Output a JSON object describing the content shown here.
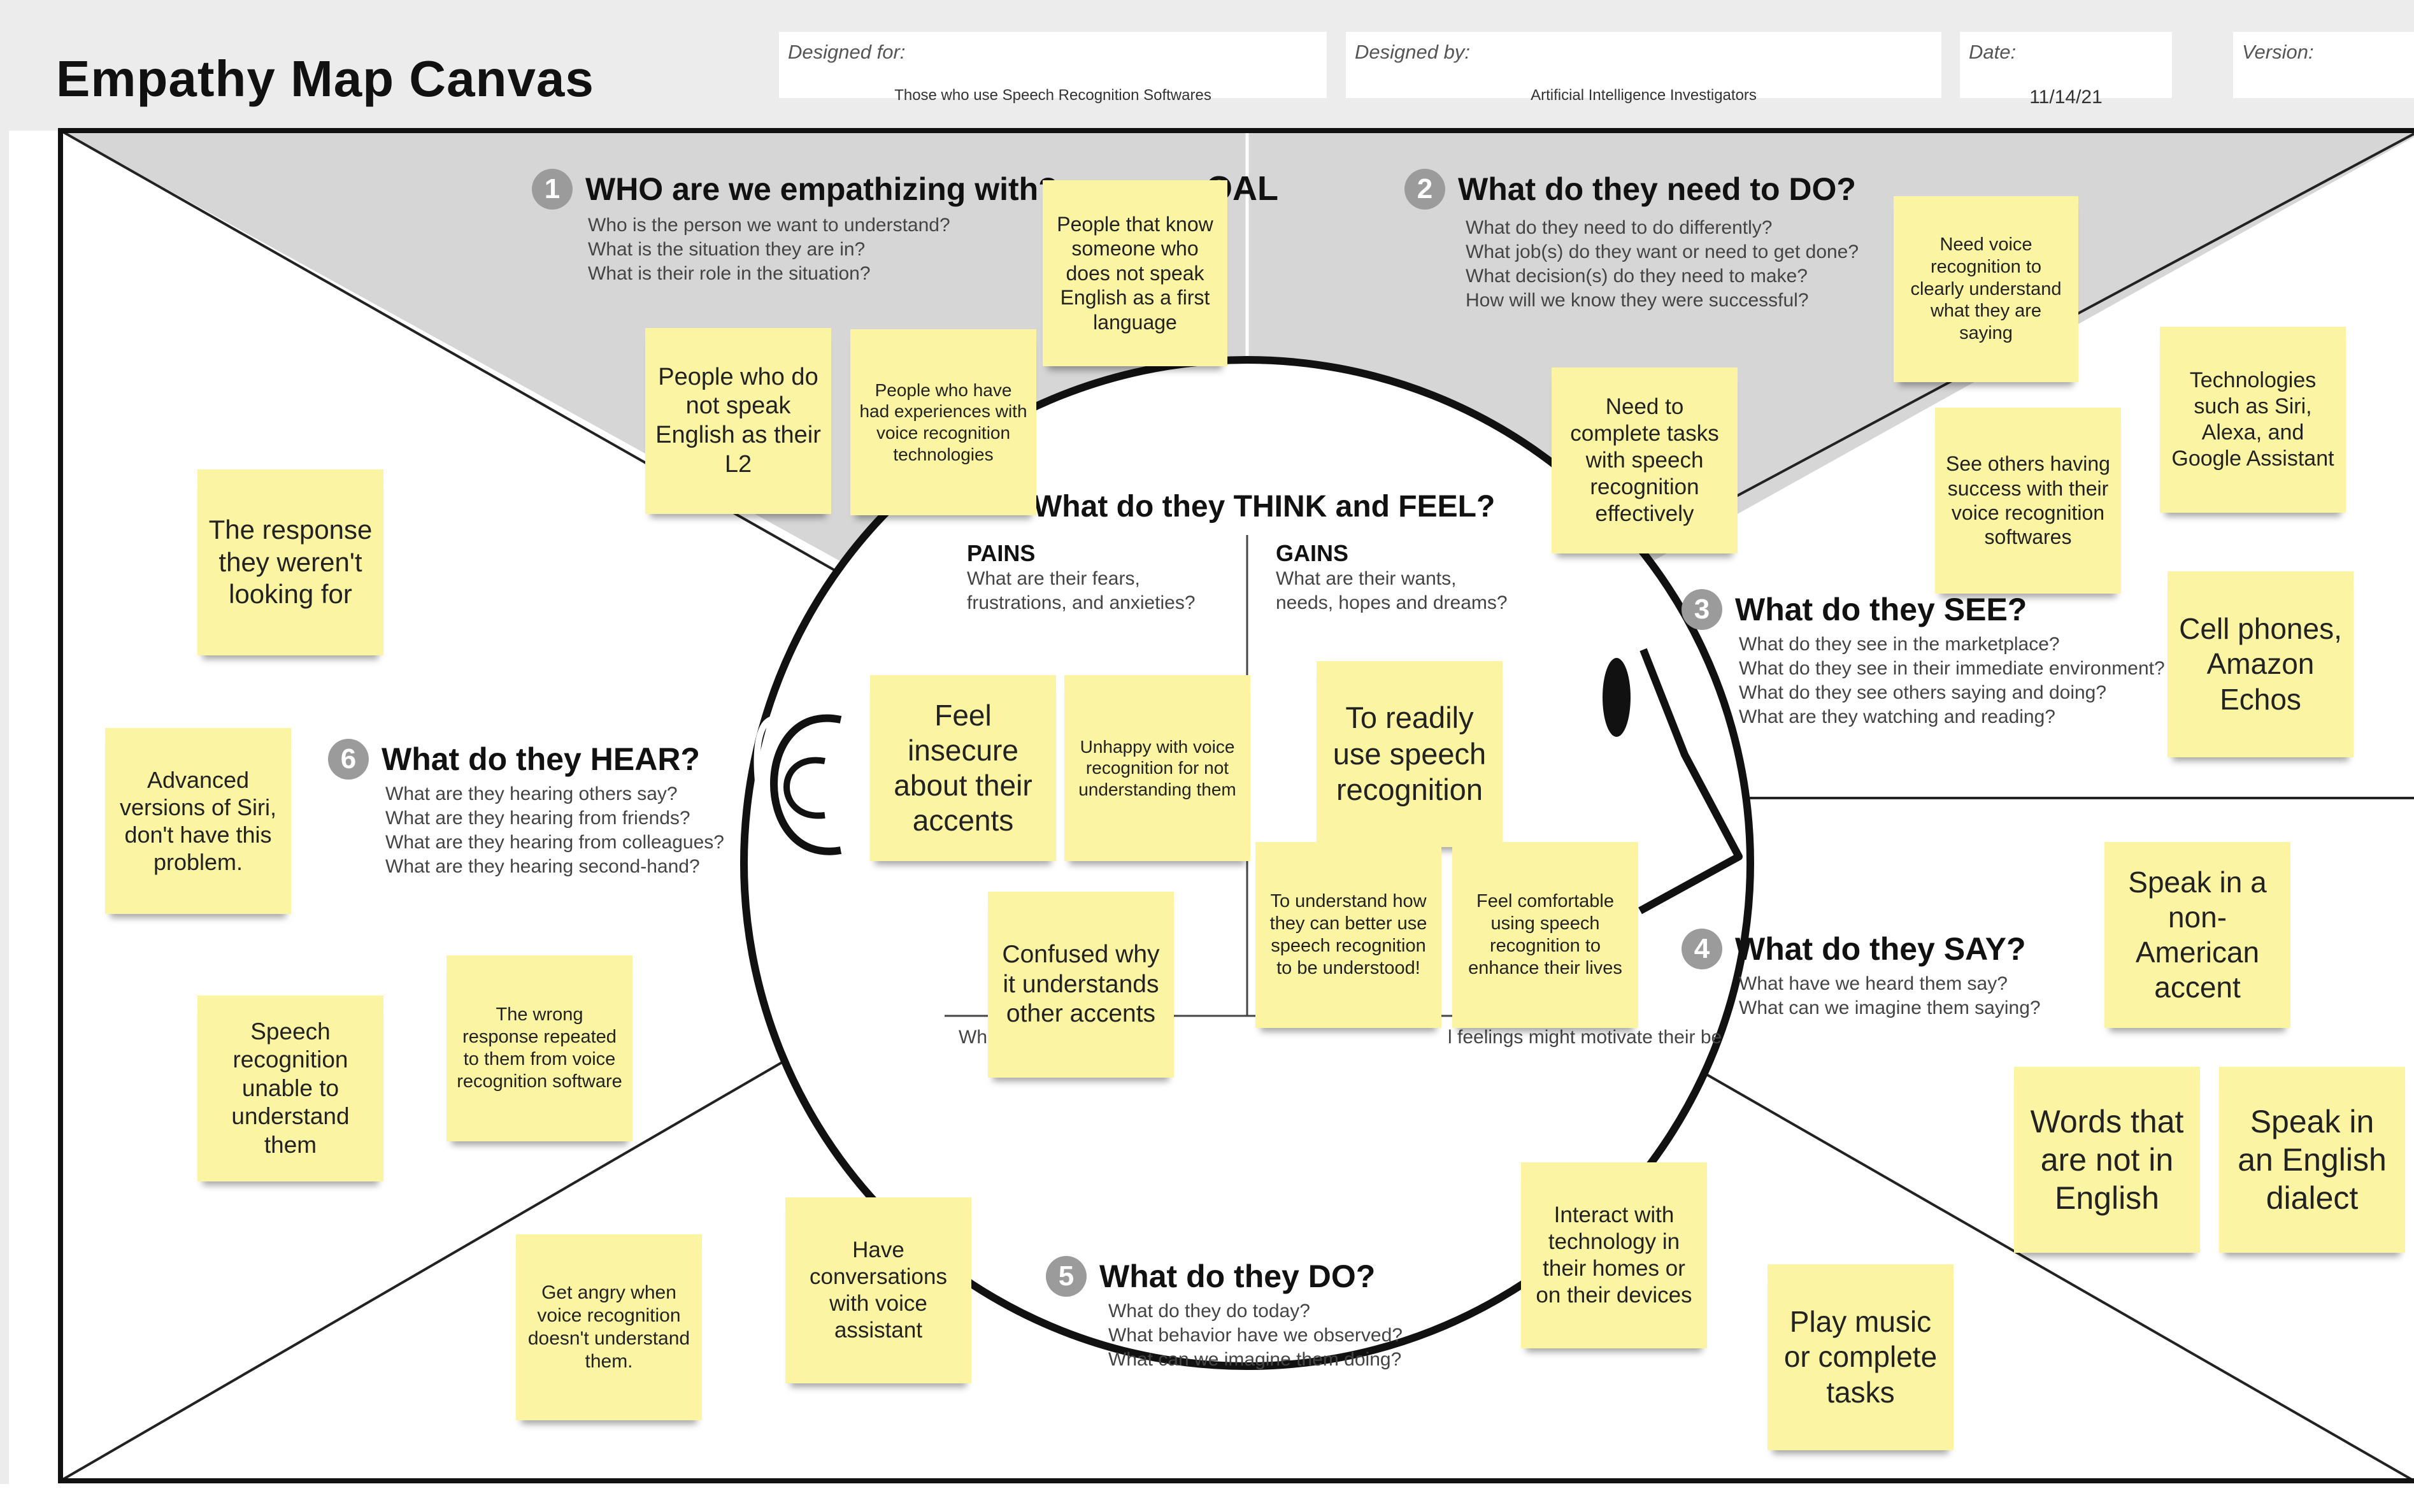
{
  "title": "Empathy Map Canvas",
  "header": {
    "designed_for": {
      "label": "Designed for:",
      "value": "Those who use Speech Recognition Softwares"
    },
    "designed_by": {
      "label": "Designed by:",
      "value": "Artificial Intelligence Investigators"
    },
    "date": {
      "label": "Date:",
      "value": "11/14/21"
    },
    "version": {
      "label": "Version:",
      "value": ""
    }
  },
  "goal_label": "OAL",
  "sections": {
    "who": {
      "number": "1",
      "title": "WHO are we empathizing with?",
      "questions": [
        "Who is the person we want to understand?",
        "What is the situation they are in?",
        "What is their role in the situation?"
      ]
    },
    "need_to_do": {
      "number": "2",
      "title": "What do they need to DO?",
      "questions": [
        "What do they need to do differently?",
        "What job(s) do they want or need to get done?",
        "What decision(s) do they need to make?",
        "How will we know they were successful?"
      ]
    },
    "see": {
      "number": "3",
      "title": "What do they SEE?",
      "questions": [
        "What do they see in the marketplace?",
        "What do they see in their immediate environment?",
        "What do they see others saying and doing?",
        "What are they watching and reading?"
      ]
    },
    "say": {
      "number": "4",
      "title": "What do they SAY?",
      "questions": [
        "What have we heard them say?",
        "What can we imagine them saying?"
      ]
    },
    "do": {
      "number": "5",
      "title": "What do they DO?",
      "questions": [
        "What do they do today?",
        "What behavior have we observed?",
        "What can we imagine them doing?"
      ]
    },
    "hear": {
      "number": "6",
      "title": "What do they HEAR?",
      "questions": [
        "What are they hearing others say?",
        "What are they hearing from friends?",
        "What are they hearing from colleagues?",
        "What are they hearing second-hand?"
      ]
    },
    "think_feel": {
      "title": "What do they THINK and FEEL?",
      "pains": {
        "title": "PAINS",
        "desc": [
          "What are their fears,",
          "frustrations, and anxieties?"
        ]
      },
      "gains": {
        "title": "GAINS",
        "desc": [
          "What are their wants,",
          "needs, hopes and dreams?"
        ]
      },
      "footer_left": "Wh",
      "footer_right": "l feelings might motivate their be"
    }
  },
  "notes": {
    "n01": "People that know someone who does not speak English as a first language",
    "n02": "People who do not speak English as their L2",
    "n03": "People who have had experiences with voice recognition technologies",
    "n04": "Need voice recognition to clearly understand what they are saying",
    "n05": "Technologies such as Siri, Alexa, and Google Assistant",
    "n06": "Need to complete tasks with speech recognition effectively",
    "n07": "See others having success with their voice recognition softwares",
    "n08": "Cell phones, Amazon Echos",
    "n09": "The response they weren't looking for",
    "n10": "Advanced versions of Siri, don't have this problem.",
    "n11": "Feel insecure about their accents",
    "n12": "Unhappy with voice recognition for not understanding them",
    "n13": "To readily use speech recognition",
    "n14": "To understand how they can better use speech recognition to be understood!",
    "n15": "Feel comfortable using speech recognition to enhance their lives",
    "n16": "Confused why it understands other accents",
    "n17": "Speak in a non-American accent",
    "n18": "The wrong response repeated to them from voice recognition software",
    "n19": "Speech recognition unable to understand them",
    "n20": "Words that are not in English",
    "n21": "Speak in an English dialect",
    "n22": "Interact with technology in their homes or on their devices",
    "n23": "Get angry when voice recognition doesn't understand them.",
    "n24": "Have conversations with voice assistant",
    "n25": "Play music or complete tasks"
  }
}
